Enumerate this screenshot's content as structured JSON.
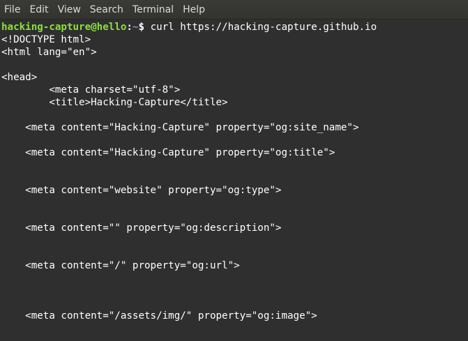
{
  "menubar": {
    "items": [
      {
        "id": "file",
        "label": "File"
      },
      {
        "id": "edit",
        "label": "Edit"
      },
      {
        "id": "view",
        "label": "View"
      },
      {
        "id": "search",
        "label": "Search"
      },
      {
        "id": "terminal",
        "label": "Terminal"
      },
      {
        "id": "help",
        "label": "Help"
      }
    ]
  },
  "prompt": {
    "user_host": "hacking-capture@hello",
    "separator": ":",
    "path": "~",
    "symbol": "$ ",
    "command": "curl https://hacking-capture.github.io"
  },
  "colors": {
    "background": "#2f2f2f",
    "user_host": "#8ae234",
    "path": "#729fcf",
    "text": "#ffffff",
    "menu_text": "#dfdbd2"
  },
  "output_lines": [
    "<!DOCTYPE html>",
    "<html lang=\"en\">",
    "",
    "<head>",
    "        <meta charset=\"utf-8\">",
    "        <title>Hacking-Capture</title>",
    "",
    "    <meta content=\"Hacking-Capture\" property=\"og:site_name\">",
    "",
    "    <meta content=\"Hacking-Capture\" property=\"og:title\">",
    "",
    "",
    "    <meta content=\"website\" property=\"og:type\">",
    "",
    "",
    "    <meta content=\"\" property=\"og:description\">",
    "",
    "",
    "    <meta content=\"/\" property=\"og:url\">",
    "",
    "",
    "",
    "    <meta content=\"/assets/img/\" property=\"og:image\">",
    "",
    ""
  ]
}
